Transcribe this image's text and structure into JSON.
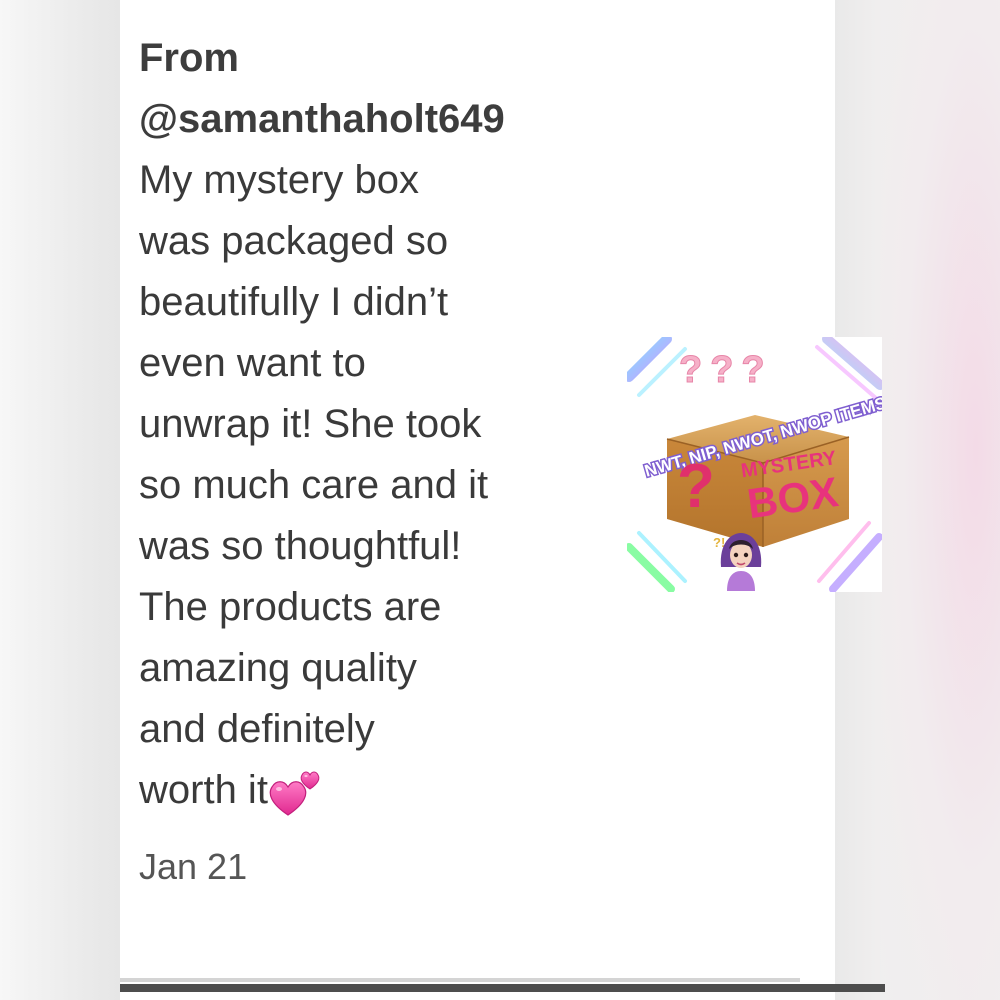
{
  "review": {
    "from_label": "From",
    "username": "@samanthaholt649",
    "body": "My mystery box\nwas packaged so\nbeautifully I didn’t\neven want to\nunwrap it! She took\nso much care and it\nwas so thoughtful!\nThe products are\namazing quality\nand definitely\nworth it",
    "emoji": "two-hearts",
    "date": "Jan 21"
  },
  "thumbnail": {
    "banner_text": "NWT, NIP, NWOT, NWOP ITEMS",
    "box_line1": "MYSTERY",
    "box_line2": "BOX",
    "question_marks": "???",
    "side_mark": "?",
    "small_marks": "?!",
    "colors": {
      "banner": "#7f5fd0",
      "box": "#c58a3e",
      "box_text": "#e8337c",
      "question": "#e0306c"
    }
  }
}
